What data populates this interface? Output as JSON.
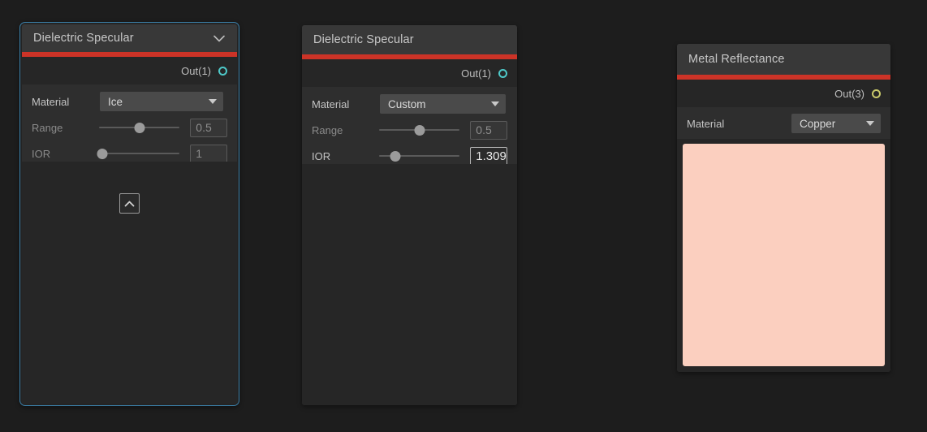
{
  "theme": {
    "canvas_bg": "#1d1d1d",
    "node_bg": "#262626",
    "header_bg": "#383838",
    "params_bg": "#2e2e2e",
    "accent_red": "#cc3327",
    "selection_border": "#3b7fa8",
    "port_cyan": "#4ec9c9",
    "port_yellow": "#c9c96a"
  },
  "nodes": [
    {
      "id": "dielectric-specular-selected",
      "title": "Dielectric Specular",
      "selected": true,
      "has_header_chevron": true,
      "port": {
        "label": "Out(1)",
        "color": "#4ec9c9"
      },
      "material": {
        "label": "Material",
        "value": "Ice"
      },
      "range": {
        "label": "Range",
        "value": "0.5",
        "slider_pct": 50,
        "dim": true,
        "active": false
      },
      "ior": {
        "label": "IOR",
        "value": "1",
        "slider_pct": 3,
        "dim": true,
        "active": false
      },
      "collapse_button": {
        "icon": "chevron-up-icon"
      }
    },
    {
      "id": "dielectric-specular-custom",
      "title": "Dielectric Specular",
      "selected": false,
      "has_header_chevron": false,
      "port": {
        "label": "Out(1)",
        "color": "#4ec9c9"
      },
      "material": {
        "label": "Material",
        "value": "Custom"
      },
      "range": {
        "label": "Range",
        "value": "0.5",
        "slider_pct": 50,
        "dim": true,
        "active": false
      },
      "ior": {
        "label": "IOR",
        "value": "1.309",
        "slider_pct": 20,
        "dim": false,
        "active": true
      }
    },
    {
      "id": "metal-reflectance",
      "title": "Metal Reflectance",
      "selected": false,
      "has_header_chevron": false,
      "port": {
        "label": "Out(3)",
        "color": "#c9c96a"
      },
      "material": {
        "label": "Material",
        "value": "Copper"
      },
      "swatch": {
        "color": "#fbcfbf"
      }
    }
  ]
}
